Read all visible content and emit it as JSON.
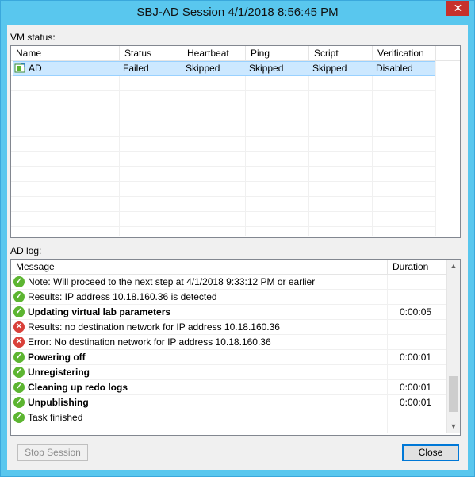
{
  "window": {
    "title": "SBJ-AD Session 4/1/2018 8:56:45 PM",
    "close_glyph": "✕"
  },
  "vm_status": {
    "label": "VM status:",
    "columns": [
      "Name",
      "Status",
      "Heartbeat",
      "Ping",
      "Script",
      "Verification"
    ],
    "rows": [
      {
        "icon": "vm-icon",
        "name": "AD",
        "status": "Failed",
        "heartbeat": "Skipped",
        "ping": "Skipped",
        "script": "Skipped",
        "verification": "Disabled"
      }
    ]
  },
  "log": {
    "label": "AD log:",
    "columns": [
      "Message",
      "Duration"
    ],
    "rows": [
      {
        "icon": "success-icon",
        "message": "Note: Will proceed to the next step at 4/1/2018 9:33:12 PM or earlier",
        "duration": "",
        "bold": false
      },
      {
        "icon": "success-icon",
        "message": "Results: IP address 10.18.160.36 is detected",
        "duration": "",
        "bold": false
      },
      {
        "icon": "success-icon",
        "message": "Updating virtual lab parameters",
        "duration": "0:00:05",
        "bold": true
      },
      {
        "icon": "error-icon",
        "message": "Results: no destination network for IP address 10.18.160.36",
        "duration": "",
        "bold": false
      },
      {
        "icon": "error-icon",
        "message": "Error: No destination network for IP address 10.18.160.36",
        "duration": "",
        "bold": false
      },
      {
        "icon": "success-icon",
        "message": "Powering off",
        "duration": "0:00:01",
        "bold": true
      },
      {
        "icon": "success-icon",
        "message": "Unregistering",
        "duration": "",
        "bold": true
      },
      {
        "icon": "success-icon",
        "message": "Cleaning up redo logs",
        "duration": "0:00:01",
        "bold": true
      },
      {
        "icon": "success-icon",
        "message": "Unpublishing",
        "duration": "0:00:01",
        "bold": true
      },
      {
        "icon": "success-icon",
        "message": "Task finished",
        "duration": "",
        "bold": false
      }
    ]
  },
  "buttons": {
    "stop_session": "Stop Session",
    "close": "Close"
  },
  "colors": {
    "titlebar": "#59c7ee",
    "success": "#5cb531",
    "error": "#d9403a",
    "selection": "#cce8ff"
  }
}
